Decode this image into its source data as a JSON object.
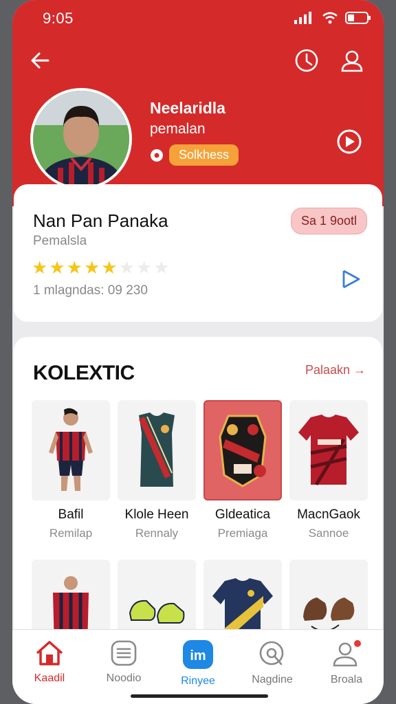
{
  "status": {
    "time": "9:05"
  },
  "header": {
    "name": "Neelaridla",
    "role": "pemalan",
    "badge": "Solkhess"
  },
  "profile": {
    "name": "Nan Pan Panaka",
    "subtitle": "Pemalsla",
    "rating": 5,
    "rating_max": 8,
    "reviews": "1 mlagndas: 09 230",
    "pill": "Sa 1 9ootl"
  },
  "collection": {
    "title": "KOLEXTIC",
    "link": "Palaakn →",
    "items": [
      {
        "title": "Bafil",
        "sub": "Remilap"
      },
      {
        "title": "Klole Heen",
        "sub": "Rennaly"
      },
      {
        "title": "Gldeatica",
        "sub": "Premiaga"
      },
      {
        "title": "MacnGaok",
        "sub": "Sannoe"
      },
      {
        "title": "",
        "sub": ""
      },
      {
        "title": "",
        "sub": ""
      },
      {
        "title": "",
        "sub": ""
      },
      {
        "title": "",
        "sub": ""
      }
    ]
  },
  "tabs": [
    {
      "label": "Kaadil",
      "icon": "home-icon",
      "active": true
    },
    {
      "label": "Noodio",
      "icon": "list-icon"
    },
    {
      "label": "Rinyee",
      "icon": "im-icon"
    },
    {
      "label": "Nagdine",
      "icon": "search-icon"
    },
    {
      "label": "Broala",
      "icon": "profile-icon"
    }
  ],
  "colors": {
    "primary": "#d52a2a",
    "accent": "#f5a23a",
    "star": "#f5c518"
  }
}
